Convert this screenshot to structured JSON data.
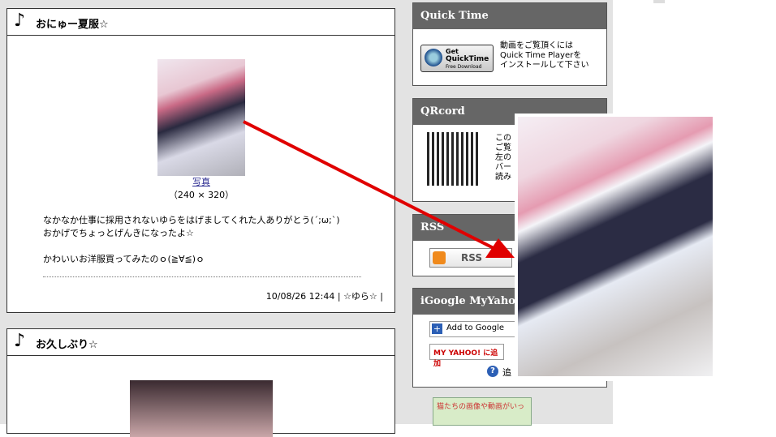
{
  "posts": [
    {
      "title": "おにゅー夏服☆",
      "photo_link": "写真",
      "photo_size": "（240 × 320）",
      "lines": [
        "なかなか仕事に採用されないゆらをはげましてくれた人ありがとう(´;ω;`)",
        "おかげでちょっとげんきになったよ☆",
        "",
        "かわいいお洋服買ってみたのｏ(≧∀≦)ｏ"
      ],
      "meta": "10/08/26 12:44 | ☆ゆら☆ |"
    },
    {
      "title": "お久しぶり☆"
    }
  ],
  "sidebar": {
    "quicktime": {
      "heading": "Quick Time",
      "button_line1": "Get",
      "button_line2": "QuickTime",
      "button_line3": "Free Download",
      "desc": [
        "動画をご覧頂くには",
        "Quick Time Playerを",
        "インストールして下さい"
      ]
    },
    "qrcode": {
      "heading": "QRcord",
      "desc": [
        "この",
        "ご覧",
        "左の",
        "バー",
        "読み"
      ]
    },
    "rss": {
      "heading": "RSS",
      "button": "RSS"
    },
    "reader": {
      "heading": "iGoogle MyYahoo!(",
      "google": "Add to Google",
      "myyahoo": "MY YAHOO! に追加",
      "help": "?",
      "help_text": "追"
    },
    "banner": "猫たちの画像や動画がいっ"
  },
  "colors": {
    "widget_header": "#666666",
    "arrow": "#e00000"
  }
}
